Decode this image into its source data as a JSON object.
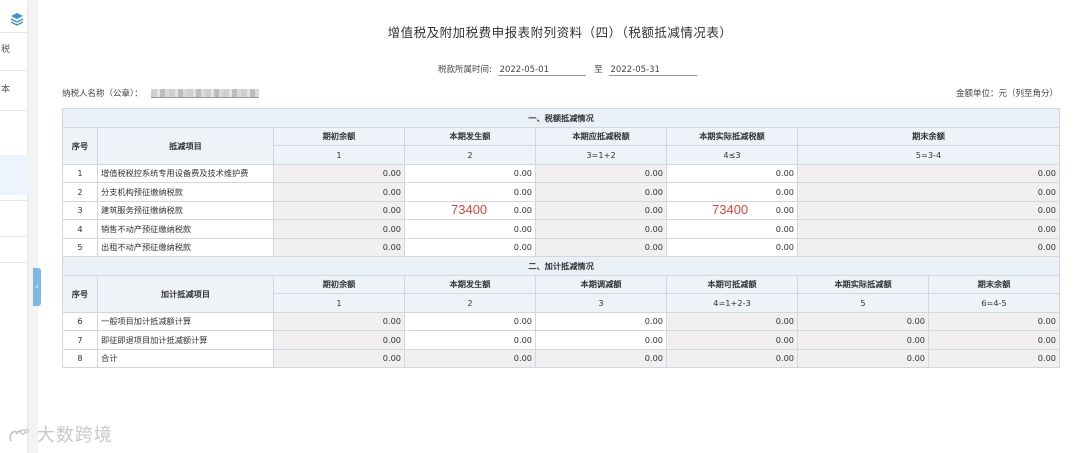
{
  "sidebar": {
    "items": [
      "税",
      "本"
    ]
  },
  "report": {
    "title": "增值税及附加税费申报表附列资料（四）（税额抵减情况表）",
    "period_label": "税款所属时间:",
    "period_start": "2022-05-01",
    "period_to": "至",
    "period_end": "2022-05-31",
    "taxpayer_label": "纳税人名称（公章）：",
    "unit_label": "金额单位：元（列至角分）"
  },
  "section1": {
    "title": "一、税额抵减情况",
    "col_seq": "序号",
    "col_item": "抵减项目",
    "headers": [
      "期初余额",
      "本期发生额",
      "本期应抵减税额",
      "本期实际抵减税额",
      "期末余额"
    ],
    "formulas": [
      "1",
      "2",
      "3=1+2",
      "4≤3",
      "5=3-4"
    ],
    "rows": [
      {
        "seq": "1",
        "name": "增值税税控系统专用设备费及技术维护费",
        "values": [
          "0.00",
          "0.00",
          "0.00",
          "0.00",
          "0.00"
        ]
      },
      {
        "seq": "2",
        "name": "分支机构预征缴纳税款",
        "values": [
          "0.00",
          "0.00",
          "0.00",
          "0.00",
          "0.00"
        ]
      },
      {
        "seq": "3",
        "name": "建筑服务预征缴纳税款",
        "values": [
          "0.00",
          "0.00",
          "0.00",
          "0.00",
          "0.00"
        ]
      },
      {
        "seq": "4",
        "name": "销售不动产预征缴纳税款",
        "values": [
          "0.00",
          "0.00",
          "0.00",
          "0.00",
          "0.00"
        ]
      },
      {
        "seq": "5",
        "name": "出租不动产预征缴纳税款",
        "values": [
          "0.00",
          "0.00",
          "0.00",
          "0.00",
          "0.00"
        ]
      }
    ],
    "annotation_col2": "73400",
    "annotation_col4": "73400"
  },
  "section2": {
    "title": "二、加计抵减情况",
    "col_seq": "序号",
    "col_item": "加计抵减项目",
    "headers": [
      "期初余额",
      "本期发生额",
      "本期调减额",
      "本期可抵减额",
      "本期实际抵减额",
      "期末余额"
    ],
    "formulas": [
      "1",
      "2",
      "3",
      "4=1+2-3",
      "5",
      "6=4-5"
    ],
    "rows": [
      {
        "seq": "6",
        "name": "一般项目加计抵减额计算",
        "values": [
          "0.00",
          "0.00",
          "0.00",
          "0.00",
          "0.00",
          "0.00"
        ]
      },
      {
        "seq": "7",
        "name": "即征即退项目加计抵减额计算",
        "values": [
          "0.00",
          "0.00",
          "0.00",
          "0.00",
          "0.00",
          "0.00"
        ]
      },
      {
        "seq": "8",
        "name": "合计",
        "values": [
          "0.00",
          "0.00",
          "0.00",
          "0.00",
          "0.00",
          "0.00"
        ]
      }
    ]
  },
  "watermark": {
    "text": "大数跨境"
  },
  "colors": {
    "accent": "#4a90d9",
    "readonly_cell": "#f1efef",
    "annotation": "#e0443c"
  }
}
